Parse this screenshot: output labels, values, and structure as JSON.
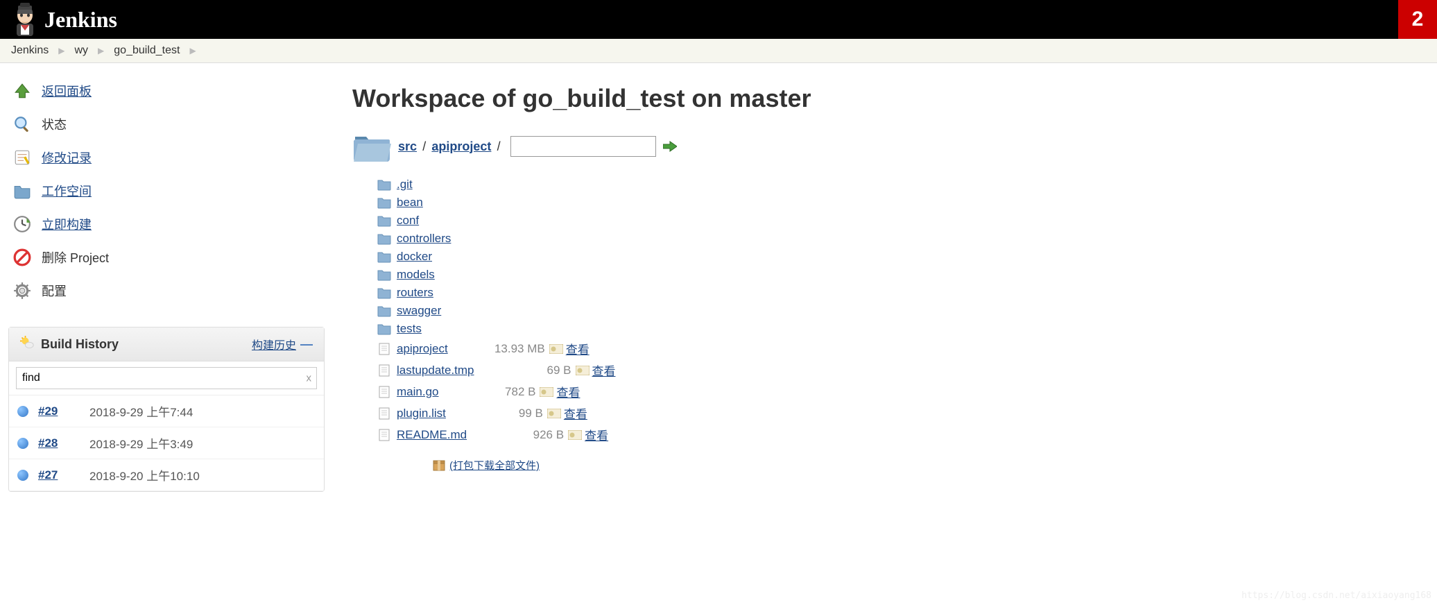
{
  "header": {
    "title": "Jenkins",
    "alert_count": "2"
  },
  "breadcrumb": {
    "items": [
      "Jenkins",
      "wy",
      "go_build_test"
    ]
  },
  "sidebar": {
    "tasks": [
      {
        "label": "返回面板",
        "icon": "up-arrow"
      },
      {
        "label": "状态",
        "icon": "search"
      },
      {
        "label": "修改记录",
        "icon": "notepad"
      },
      {
        "label": "工作空间",
        "icon": "folder"
      },
      {
        "label": "立即构建",
        "icon": "clock"
      },
      {
        "label": "删除 Project",
        "icon": "forbidden"
      },
      {
        "label": "配置",
        "icon": "gear"
      }
    ]
  },
  "build_history": {
    "title": "Build History",
    "trend_label": "构建历史",
    "find_value": "find",
    "builds": [
      {
        "num": "#29",
        "time": "2018-9-29 上午7:44"
      },
      {
        "num": "#28",
        "time": "2018-9-29 上午3:49"
      },
      {
        "num": "#27",
        "time": "2018-9-20 上午10:10"
      }
    ]
  },
  "main": {
    "title": "Workspace of go_build_test on master",
    "path": {
      "parts": [
        "src",
        "apiproject"
      ],
      "input": ""
    },
    "folders": [
      ".git",
      "bean",
      "conf",
      "controllers",
      "docker",
      "models",
      "routers",
      "swagger",
      "tests"
    ],
    "files": [
      {
        "name": "apiproject",
        "size": "13.93 MB",
        "view": "查看"
      },
      {
        "name": "lastupdate.tmp",
        "size": "69 B",
        "view": "查看"
      },
      {
        "name": "main.go",
        "size": "782 B",
        "view": "查看"
      },
      {
        "name": "plugin.list",
        "size": "99 B",
        "view": "查看"
      },
      {
        "name": "README.md",
        "size": "926 B",
        "view": "查看"
      }
    ],
    "download_all": " (打包下载全部文件)"
  },
  "watermark": "https://blog.csdn.net/aixiaoyang168"
}
